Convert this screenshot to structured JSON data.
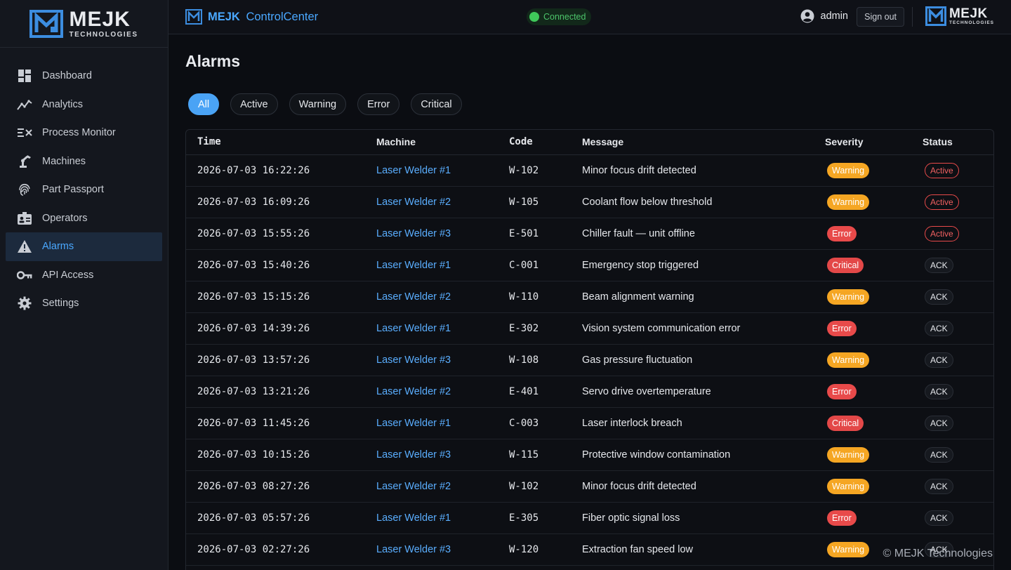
{
  "logo": {
    "name": "MEJK",
    "tagline": "TECHNOLOGIES"
  },
  "header": {
    "brand_name": "MEJK",
    "app_name": "ControlCenter",
    "connection_status": "Connected",
    "username": "admin",
    "signout_label": "Sign out"
  },
  "nav": {
    "items": [
      {
        "label": "Dashboard",
        "icon": "dashboard-icon"
      },
      {
        "label": "Analytics",
        "icon": "analytics-icon"
      },
      {
        "label": "Process Monitor",
        "icon": "process-monitor-icon"
      },
      {
        "label": "Machines",
        "icon": "robot-arm-icon"
      },
      {
        "label": "Part Passport",
        "icon": "fingerprint-icon"
      },
      {
        "label": "Operators",
        "icon": "badge-icon"
      },
      {
        "label": "Alarms",
        "icon": "warning-icon",
        "active": true
      },
      {
        "label": "API Access",
        "icon": "key-icon"
      },
      {
        "label": "Settings",
        "icon": "gear-icon"
      }
    ]
  },
  "page": {
    "title": "Alarms"
  },
  "filters": [
    {
      "label": "All",
      "active": true
    },
    {
      "label": "Active"
    },
    {
      "label": "Warning"
    },
    {
      "label": "Error"
    },
    {
      "label": "Critical"
    }
  ],
  "table": {
    "columns": [
      "Time",
      "Machine",
      "Code",
      "Message",
      "Severity",
      "Status"
    ],
    "rows": [
      {
        "time": "2026-07-03 16:22:26",
        "machine": "Laser Welder #1",
        "code": "W-102",
        "message": "Minor focus drift detected",
        "severity": "Warning",
        "status": "Active"
      },
      {
        "time": "2026-07-03 16:09:26",
        "machine": "Laser Welder #2",
        "code": "W-105",
        "message": "Coolant flow below threshold",
        "severity": "Warning",
        "status": "Active"
      },
      {
        "time": "2026-07-03 15:55:26",
        "machine": "Laser Welder #3",
        "code": "E-501",
        "message": "Chiller fault — unit offline",
        "severity": "Error",
        "status": "Active"
      },
      {
        "time": "2026-07-03 15:40:26",
        "machine": "Laser Welder #1",
        "code": "C-001",
        "message": "Emergency stop triggered",
        "severity": "Critical",
        "status": "ACK"
      },
      {
        "time": "2026-07-03 15:15:26",
        "machine": "Laser Welder #2",
        "code": "W-110",
        "message": "Beam alignment warning",
        "severity": "Warning",
        "status": "ACK"
      },
      {
        "time": "2026-07-03 14:39:26",
        "machine": "Laser Welder #1",
        "code": "E-302",
        "message": "Vision system communication error",
        "severity": "Error",
        "status": "ACK"
      },
      {
        "time": "2026-07-03 13:57:26",
        "machine": "Laser Welder #3",
        "code": "W-108",
        "message": "Gas pressure fluctuation",
        "severity": "Warning",
        "status": "ACK"
      },
      {
        "time": "2026-07-03 13:21:26",
        "machine": "Laser Welder #2",
        "code": "E-401",
        "message": "Servo drive overtemperature",
        "severity": "Error",
        "status": "ACK"
      },
      {
        "time": "2026-07-03 11:45:26",
        "machine": "Laser Welder #1",
        "code": "C-003",
        "message": "Laser interlock breach",
        "severity": "Critical",
        "status": "ACK"
      },
      {
        "time": "2026-07-03 10:15:26",
        "machine": "Laser Welder #3",
        "code": "W-115",
        "message": "Protective window contamination",
        "severity": "Warning",
        "status": "ACK"
      },
      {
        "time": "2026-07-03 08:27:26",
        "machine": "Laser Welder #2",
        "code": "W-102",
        "message": "Minor focus drift detected",
        "severity": "Warning",
        "status": "ACK"
      },
      {
        "time": "2026-07-03 05:57:26",
        "machine": "Laser Welder #1",
        "code": "E-305",
        "message": "Fiber optic signal loss",
        "severity": "Error",
        "status": "ACK"
      },
      {
        "time": "2026-07-03 02:27:26",
        "machine": "Laser Welder #3",
        "code": "W-120",
        "message": "Extraction fan speed low",
        "severity": "Warning",
        "status": "ACK"
      }
    ]
  },
  "footer": {
    "copyright": "© MEJK Technologies"
  },
  "colors": {
    "accent": "#4aa8ff",
    "connected": "#3fc85a",
    "warning": "#f5a623",
    "error": "#e84a4a",
    "critical": "#e34848"
  }
}
